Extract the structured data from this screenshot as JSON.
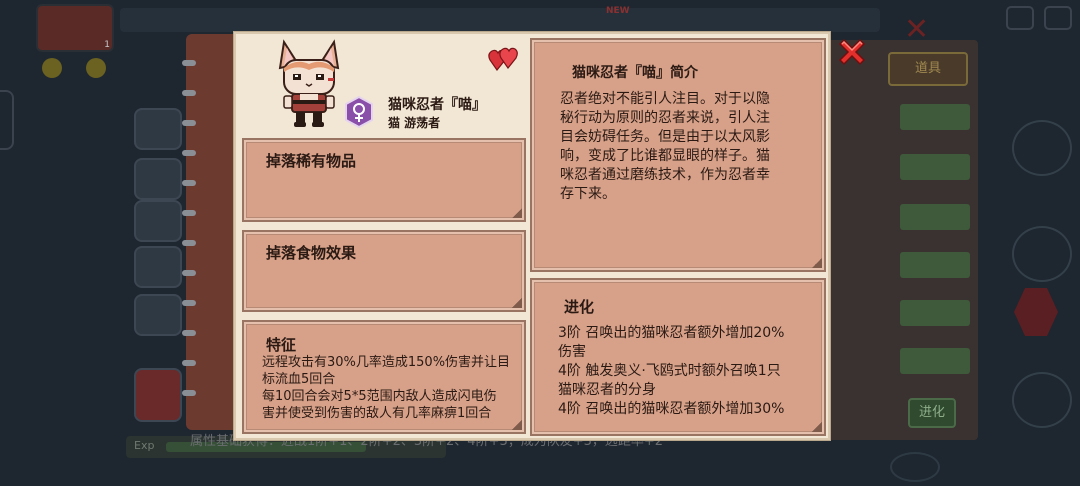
{
  "background": {
    "avatar_level": "1",
    "new_tag": "NEW",
    "side_tabs": [
      "道具",
      "进化"
    ],
    "exp_label": "Exp",
    "bottom_text": "属性基础获得：近战1阶+1、2阶+2、3阶+2、4阶+3；成为队友+3，远距率+2"
  },
  "character": {
    "name": "猫咪忍者『喵』",
    "subtitle": "猫 游荡者",
    "gender_icon": "female-icon",
    "favorite_icon": "double-heart-icon"
  },
  "drop_rare": {
    "title": "掉落稀有物品"
  },
  "drop_food": {
    "title": "掉落食物效果"
  },
  "traits": {
    "title": "特征",
    "lines": [
      "远程攻击有30%几率造成150%伤害并让目",
      "标流血5回合",
      "每10回合会对5*5范围内敌人造成闪电伤",
      "害并使受到伤害的敌人有几率麻痹1回合"
    ]
  },
  "intro": {
    "title": "猫咪忍者『喵』简介",
    "lines": [
      "忍者绝对不能引人注目。对于以隐",
      "秘行动为原则的忍者来说，引人注",
      "目会妨碍任务。但是由于以太风影",
      "响，变成了比谁都显眼的样子。猫",
      "咪忍者通过磨练技术，作为忍者幸",
      "存下来。"
    ]
  },
  "evolution": {
    "title": "进化",
    "lines": [
      "3阶 召唤出的猫咪忍者额外增加20%",
      "伤害",
      "4阶 触发奥义·飞鸥式时额外召唤1只",
      "猫咪忍者的分身",
      "4阶 召唤出的猫咪忍者额外增加30%"
    ]
  },
  "close": {
    "icon": "close-icon"
  },
  "colors": {
    "popup_bg": "#f2e7d4",
    "card_bg": "#d7a189",
    "badge": "#8a4fa8",
    "close": "#e4302c",
    "heart": "#d8323a"
  }
}
